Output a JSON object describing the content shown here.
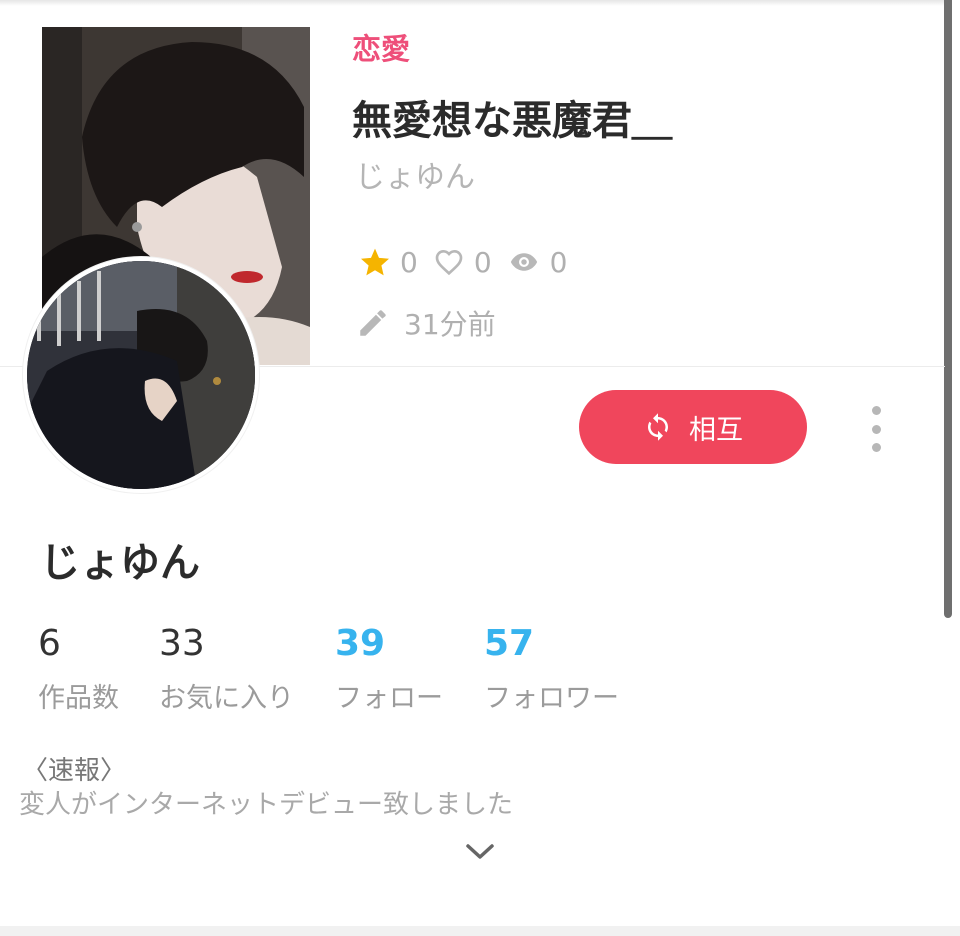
{
  "story": {
    "genre": "恋愛",
    "title": "無愛想な悪魔君＿",
    "author": "じょゆん",
    "stars": "0",
    "likes": "0",
    "views": "0",
    "updated": "31分前",
    "cover_icon": "cover-photo"
  },
  "profile": {
    "name": "じょゆん",
    "avatar_icon": "avatar-photo",
    "mutual_label": "相互",
    "counts": [
      {
        "value": "6",
        "label": "作品数",
        "accent": false
      },
      {
        "value": "33",
        "label": "お気に入り",
        "accent": false
      },
      {
        "value": "39",
        "label": "フォロー",
        "accent": true
      },
      {
        "value": "57",
        "label": "フォロワー",
        "accent": true
      }
    ],
    "bio_heading": "〈速報〉",
    "bio_text": "変人がインターネットデビュー致しました"
  },
  "colors": {
    "genre": "#ee4f7a",
    "mutual_button": "#f0465c",
    "accent_count": "#37b3ee",
    "star": "#f5b400"
  }
}
